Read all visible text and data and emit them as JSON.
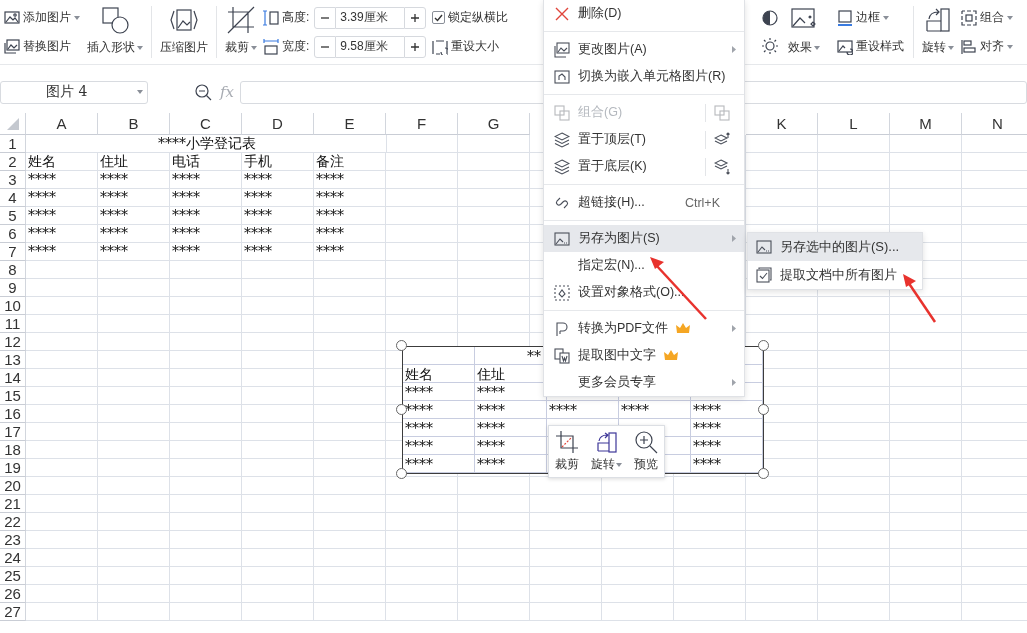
{
  "ribbon": {
    "add_picture": {
      "label": "添加图片",
      "dropdown": true
    },
    "replace_picture": {
      "label": "替换图片",
      "dropdown": false
    },
    "insert_shape": {
      "label": "插入形状",
      "dropdown": true
    },
    "compress": {
      "label": "压缩图片",
      "dropdown": false
    },
    "crop": {
      "label": "裁剪",
      "dropdown": true
    },
    "height": {
      "label": "高度:",
      "value": "3.39厘米"
    },
    "width": {
      "label": "宽度:",
      "value": "9.58厘米"
    },
    "lock_ratio": {
      "label": "锁定纵横比",
      "checked": true
    },
    "reset_size": {
      "label": "重设大小",
      "dropdown": false
    },
    "effects": {
      "label": "效果",
      "dropdown": true
    },
    "border": {
      "label": "边框",
      "dropdown": true
    },
    "reset_style": {
      "label": "重设样式",
      "dropdown": false
    },
    "rotate": {
      "label": "旋转",
      "dropdown": true
    },
    "group": {
      "label": "组合",
      "dropdown": true
    },
    "align": {
      "label": "对齐",
      "dropdown": true
    }
  },
  "name_box": "图片 4",
  "fx_label": "fx",
  "sheet": {
    "columns": [
      "A",
      "B",
      "C",
      "D",
      "E",
      "F",
      "G",
      null,
      null,
      null,
      "K",
      "L",
      "M",
      "N"
    ],
    "rows": [
      {
        "header": "1",
        "title": "****小学登记表"
      },
      {
        "header": "2",
        "cells": [
          "姓名",
          "住址",
          "电话",
          "手机",
          "备注"
        ]
      },
      {
        "header": "3",
        "cells": [
          "****",
          "****",
          "****",
          "****",
          "****"
        ]
      },
      {
        "header": "4",
        "cells": [
          "****",
          "****",
          "****",
          "****",
          "****"
        ]
      },
      {
        "header": "5",
        "cells": [
          "****",
          "****",
          "****",
          "****",
          "****"
        ]
      },
      {
        "header": "6",
        "cells": [
          "****",
          "****",
          "****",
          "****",
          "****"
        ]
      },
      {
        "header": "7",
        "cells": [
          "****",
          "****",
          "****",
          "****",
          "****"
        ]
      },
      {
        "header": "8"
      },
      {
        "header": "9"
      },
      {
        "header": "10"
      },
      {
        "header": "11"
      },
      {
        "header": "12"
      },
      {
        "header": "13"
      },
      {
        "header": "14"
      },
      {
        "header": "15"
      },
      {
        "header": "16"
      },
      {
        "header": "17"
      },
      {
        "header": "18"
      },
      {
        "header": "19"
      },
      {
        "header": "20"
      },
      {
        "header": "21"
      },
      {
        "header": "22"
      },
      {
        "header": "23"
      },
      {
        "header": "24"
      },
      {
        "header": "25"
      },
      {
        "header": "26"
      },
      {
        "header": "27"
      }
    ]
  },
  "picture": {
    "title": "**",
    "rows": [
      [
        "姓名",
        "住址",
        null,
        null,
        null
      ],
      [
        "****",
        "****",
        null,
        null,
        null
      ],
      [
        "****",
        "****",
        "****",
        "****",
        "****"
      ],
      [
        "****",
        "****",
        null,
        null,
        "****"
      ],
      [
        "****",
        "****",
        null,
        null,
        "****"
      ],
      [
        "****",
        "****",
        null,
        null,
        "****"
      ]
    ]
  },
  "mini_toolbar": {
    "buttons": [
      {
        "label": "裁剪",
        "dropdown": false
      },
      {
        "label": "旋转",
        "dropdown": true
      },
      {
        "label": "预览",
        "dropdown": false
      }
    ]
  },
  "context_menu": {
    "items": [
      {
        "kind": "item",
        "label": "删除(D)",
        "submenu": false,
        "disabled": false,
        "selected": false,
        "premium": false,
        "side_button": false
      },
      {
        "kind": "separator"
      },
      {
        "kind": "item",
        "label": "更改图片(A)",
        "submenu": true,
        "disabled": false,
        "selected": false,
        "premium": false,
        "side_button": false
      },
      {
        "kind": "item",
        "label": "切换为嵌入单元格图片(R)",
        "submenu": false,
        "disabled": false,
        "selected": false,
        "premium": false,
        "side_button": false
      },
      {
        "kind": "separator"
      },
      {
        "kind": "item",
        "label": "组合(G)",
        "submenu": false,
        "disabled": true,
        "selected": false,
        "premium": false,
        "side_button": true
      },
      {
        "kind": "item",
        "label": "置于顶层(T)",
        "submenu": false,
        "disabled": false,
        "selected": false,
        "premium": false,
        "side_button": true
      },
      {
        "kind": "item",
        "label": "置于底层(K)",
        "submenu": false,
        "disabled": false,
        "selected": false,
        "premium": false,
        "side_button": true
      },
      {
        "kind": "separator"
      },
      {
        "kind": "item",
        "label": "超链接(H)...",
        "shortcut": "Ctrl+K",
        "submenu": false,
        "disabled": false,
        "selected": false,
        "premium": false,
        "side_button": false
      },
      {
        "kind": "separator"
      },
      {
        "kind": "item",
        "label": "另存为图片(S)",
        "submenu": true,
        "disabled": false,
        "selected": true,
        "premium": false,
        "side_button": false
      },
      {
        "kind": "item",
        "label": "指定宏(N)...",
        "submenu": false,
        "disabled": false,
        "selected": false,
        "premium": false,
        "side_button": false
      },
      {
        "kind": "item",
        "label": "设置对象格式(O)...",
        "submenu": false,
        "disabled": false,
        "selected": false,
        "premium": false,
        "side_button": false
      },
      {
        "kind": "separator"
      },
      {
        "kind": "item",
        "label": "转换为PDF文件",
        "submenu": true,
        "disabled": false,
        "selected": false,
        "premium": true,
        "side_button": false
      },
      {
        "kind": "item",
        "label": "提取图中文字",
        "submenu": false,
        "disabled": false,
        "selected": false,
        "premium": true,
        "side_button": false
      },
      {
        "kind": "item",
        "label": "更多会员专享",
        "submenu": true,
        "disabled": false,
        "selected": false,
        "premium": false,
        "side_button": false
      }
    ]
  },
  "submenu": {
    "items": [
      {
        "label": "另存选中的图片(S)...",
        "selected": true
      },
      {
        "label": "提取文档中所有图片",
        "selected": false
      }
    ]
  }
}
